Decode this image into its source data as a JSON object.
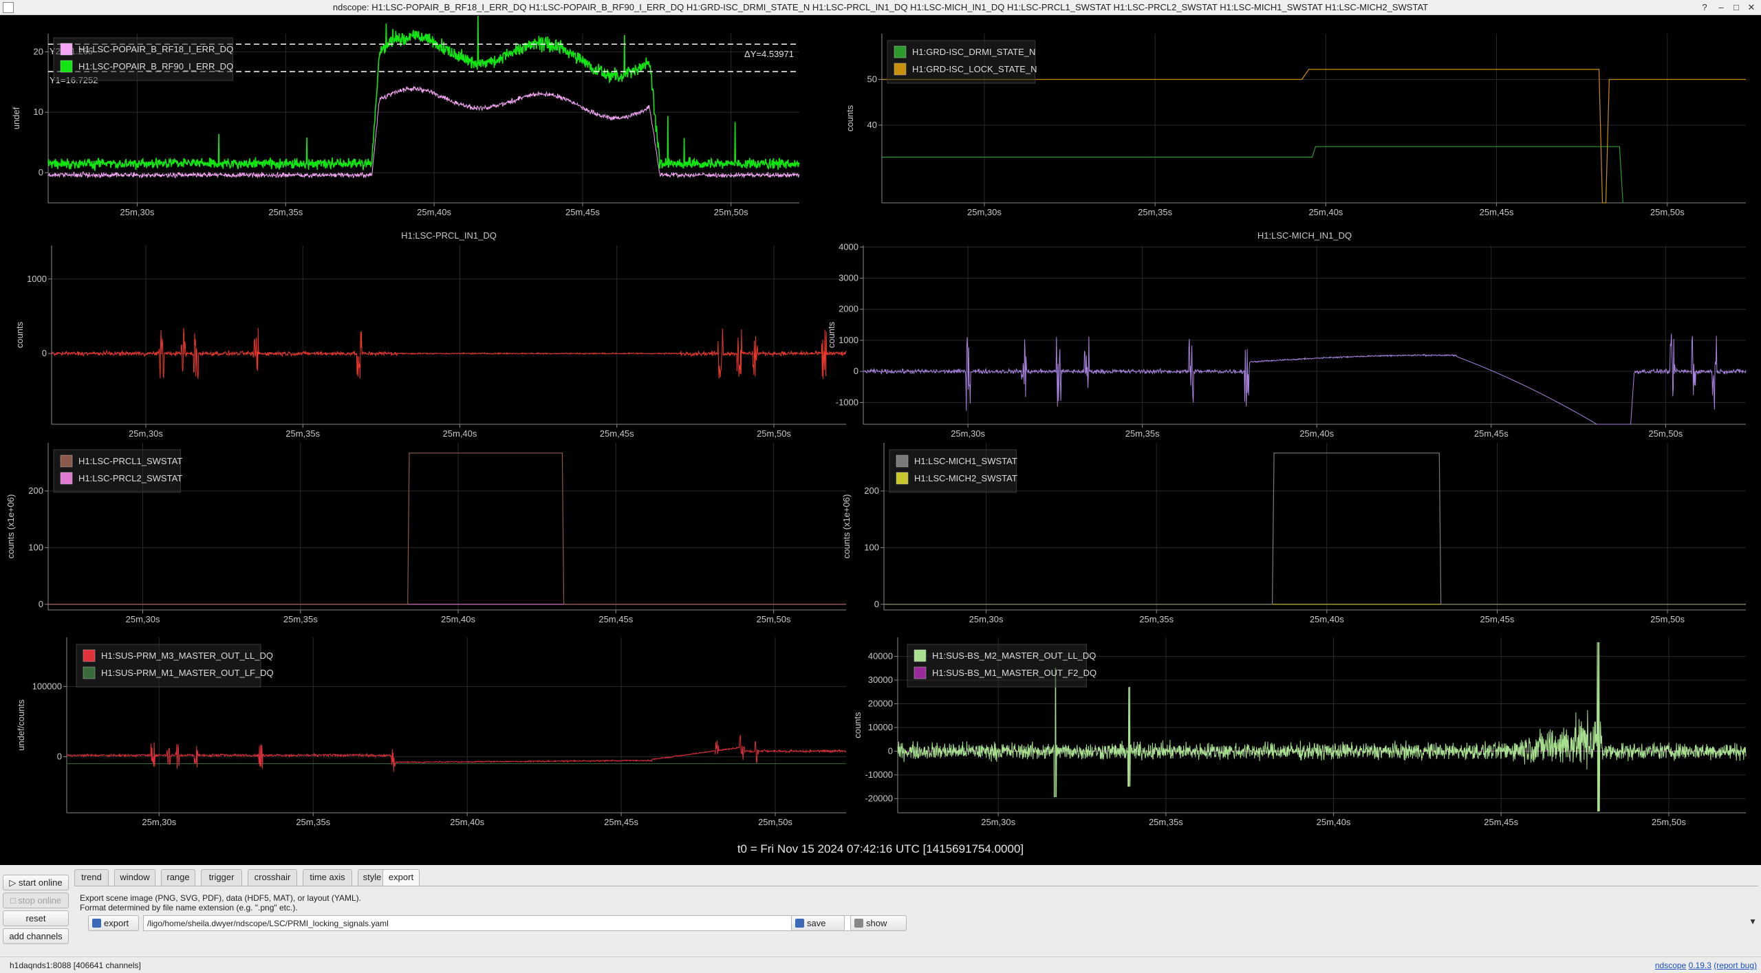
{
  "window": {
    "title": "ndscope: H1:LSC-POPAIR_B_RF18_I_ERR_DQ H1:LSC-POPAIR_B_RF90_I_ERR_DQ H1:GRD-ISC_DRMI_STATE_N H1:LSC-PRCL_IN1_DQ H1:LSC-MICH_IN1_DQ H1:LSC-PRCL1_SWSTAT H1:LSC-PRCL2_SWSTAT H1:LSC-MICH1_SWSTAT H1:LSC-MICH2_SWSTAT",
    "btn_help": "?",
    "btn_min": "‒",
    "btn_max": "□",
    "btn_close": "✕"
  },
  "x_ticks": [
    "25m,30s",
    "25m,35s",
    "25m,40s",
    "25m,45s",
    "25m,50s"
  ],
  "x_tick_seconds": [
    30,
    35,
    40,
    45,
    50
  ],
  "x_range": [
    27.0,
    52.3
  ],
  "t0_label": "t0 = Fri Nov 15 2024 07:42:16 UTC [1415691754.0000]",
  "plots": [
    {
      "id": "p1",
      "title": "",
      "ylabel": "undef",
      "yticks": [
        "20",
        "10",
        "0"
      ],
      "ytick_values": [
        20,
        10,
        0
      ],
      "ylim": [
        -5,
        23
      ],
      "grid": true,
      "legend": [
        {
          "label": "H1:LSC-POPAIR_B_RF18_I_ERR_DQ",
          "color": "#f4a6f4"
        },
        {
          "label": "H1:LSC-POPAIR_B_RF90_I_ERR_DQ",
          "color": "#12e612"
        }
      ],
      "cursors": {
        "y2_label": "Y2=21.265",
        "y1_label": "Y1=16.7252",
        "dy_label": "ΔY=4.53971",
        "y2": 21.265,
        "y1": 16.7252
      }
    },
    {
      "id": "p2",
      "title": "",
      "ylabel": "counts",
      "yticks": [
        "50",
        "40"
      ],
      "ytick_values": [
        50,
        40
      ],
      "ylim": [
        23,
        60
      ],
      "grid": true,
      "legend": [
        {
          "label": "H1:GRD-ISC_DRMI_STATE_N",
          "color": "#2e9a2e"
        },
        {
          "label": "H1:GRD-ISC_LOCK_STATE_N",
          "color": "#c8900a"
        }
      ]
    },
    {
      "id": "p3",
      "title": "H1:LSC-PRCL_IN1_DQ",
      "ylabel": "counts",
      "yticks": [
        "1000",
        "0"
      ],
      "ytick_values": [
        1000,
        0
      ],
      "ylim": [
        -950,
        1450
      ],
      "grid": true,
      "legend": [],
      "trace_color": "#e8372c"
    },
    {
      "id": "p4",
      "title": "H1:LSC-MICH_IN1_DQ",
      "ylabel": "counts",
      "yticks": [
        "4000",
        "3000",
        "2000",
        "1000",
        "0",
        "-1000"
      ],
      "ytick_values": [
        4000,
        3000,
        2000,
        1000,
        0,
        -1000
      ],
      "ylim": [
        -1700,
        4050
      ],
      "grid": true,
      "legend": [],
      "trace_color": "#a884e0"
    },
    {
      "id": "p5",
      "title": "",
      "ylabel": "counts (x1e+06)",
      "yticks": [
        "200",
        "100",
        "0"
      ],
      "ytick_values": [
        200,
        100,
        0
      ],
      "ylim": [
        -10,
        285
      ],
      "grid": true,
      "legend": [
        {
          "label": "H1:LSC-PRCL1_SWSTAT",
          "color": "#8c5a4a"
        },
        {
          "label": "H1:LSC-PRCL2_SWSTAT",
          "color": "#e07ad0"
        }
      ],
      "step": {
        "on": 38.4,
        "off": 43.3,
        "high": 267
      }
    },
    {
      "id": "p6",
      "title": "",
      "ylabel": "counts (x1e+06)",
      "yticks": [
        "200",
        "100",
        "0"
      ],
      "ytick_values": [
        200,
        100,
        0
      ],
      "ylim": [
        -10,
        285
      ],
      "grid": true,
      "legend": [
        {
          "label": "H1:LSC-MICH1_SWSTAT",
          "color": "#7a7a7a"
        },
        {
          "label": "H1:LSC-MICH2_SWSTAT",
          "color": "#c8c82a"
        }
      ],
      "step": {
        "on": 38.4,
        "off": 43.3,
        "high": 267
      }
    },
    {
      "id": "p7",
      "title": "",
      "ylabel": "undef/counts",
      "yticks": [
        "100000",
        "0"
      ],
      "ytick_values": [
        100000,
        0
      ],
      "ylim": [
        -80000,
        170000
      ],
      "grid": true,
      "legend": [
        {
          "label": "H1:SUS-PRM_M3_MASTER_OUT_LL_DQ",
          "color": "#e0303a"
        },
        {
          "label": "H1:SUS-PRM_M1_MASTER_OUT_LF_DQ",
          "color": "#3a6a3a"
        }
      ]
    },
    {
      "id": "p8",
      "title": "",
      "ylabel": "counts",
      "yticks": [
        "40000",
        "30000",
        "20000",
        "10000",
        "0",
        "-10000",
        "-20000"
      ],
      "ytick_values": [
        40000,
        30000,
        20000,
        10000,
        0,
        -10000,
        -20000
      ],
      "ylim": [
        -26000,
        48000
      ],
      "grid": true,
      "legend": [
        {
          "label": "H1:SUS-BS_M2_MASTER_OUT_LL_DQ",
          "color": "#a8e090"
        },
        {
          "label": "H1:SUS-BS_M1_MASTER_OUT_F2_DQ",
          "color": "#9a2a9a"
        }
      ]
    }
  ],
  "controls": {
    "start_online": "start online",
    "stop_online": "stop online",
    "reset": "reset",
    "add_channels": "add channels",
    "tabs": [
      "trend",
      "window",
      "range",
      "trigger",
      "crosshair",
      "time axis",
      "style",
      "export"
    ],
    "active_tab": "export",
    "help_line1": "Export scene image (PNG, SVG, PDF), data (HDF5, MAT), or layout (YAML).",
    "help_line2": "Format determined by file name extension (e.g. \".png\" etc.).",
    "export_btn": "export",
    "export_path": "/ligo/home/sheila.dwyer/ndscope/LSC/PRMI_locking_signals.yaml",
    "save_btn": "save",
    "show_btn": "show",
    "expand_icon": "▼"
  },
  "status": {
    "server": "h1daqnds1:8088",
    "channels": "[406641 channels]",
    "app_link": "ndscope",
    "version": "0.19.3",
    "report_bug": "(report bug)"
  }
}
